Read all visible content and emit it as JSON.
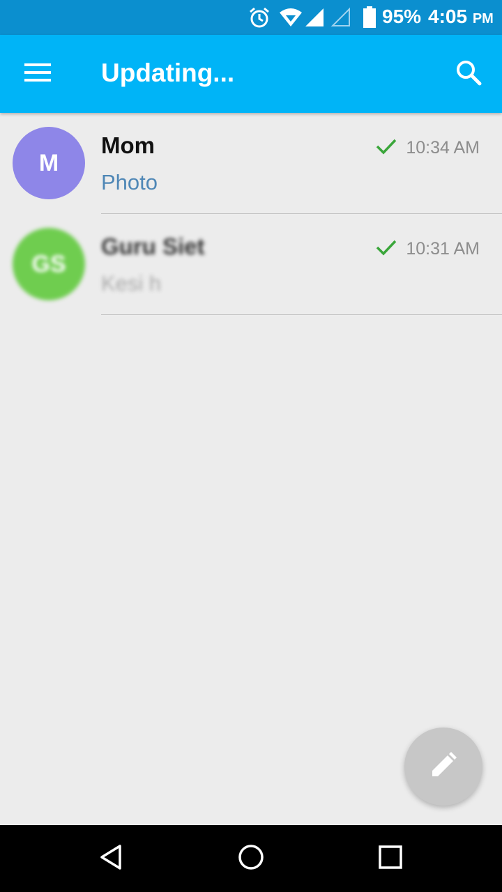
{
  "status_bar": {
    "battery_percent": "95%",
    "time": "4:05",
    "ampm": "PM",
    "icons": [
      "alarm-icon",
      "wifi-icon",
      "signal-icon",
      "signal-empty-icon",
      "battery-icon"
    ]
  },
  "app_bar": {
    "title": "Updating...",
    "menu_icon": "hamburger-menu-icon",
    "search_icon": "search-icon"
  },
  "chats": [
    {
      "initials": "M",
      "name": "Mom",
      "preview": "Photo",
      "time": "10:34 AM",
      "avatar_color": "#8e86e8",
      "status_icon": "check-icon"
    },
    {
      "initials": "GS",
      "name": "Guru Siet",
      "preview": "Kesi h",
      "time": "10:31 AM",
      "avatar_color": "#6fcd4f",
      "status_icon": "check-icon"
    }
  ],
  "fab": {
    "icon": "pencil-icon"
  },
  "nav_bar": {
    "icons": [
      "back-icon",
      "home-icon",
      "recents-icon"
    ]
  },
  "colors": {
    "status_bar": "#0b8fcf",
    "app_bar": "#00b4f7",
    "background": "#ececec",
    "preview_text": "#4f87b6",
    "check": "#3aa63a"
  }
}
